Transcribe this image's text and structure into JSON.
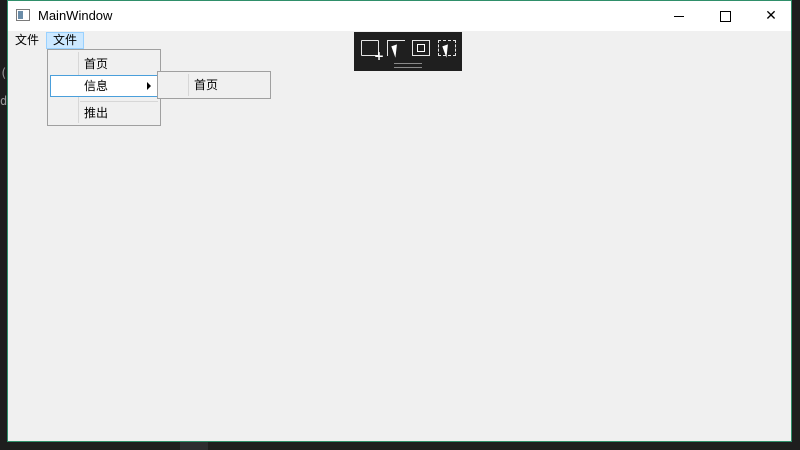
{
  "window": {
    "title": "MainWindow",
    "close_glyph": "✕",
    "border_color": "#2f8f6a"
  },
  "background_fragments": [
    "(/",
    "d"
  ],
  "menubar": {
    "items": [
      {
        "label": "文件"
      },
      {
        "label": "文件",
        "state": "open"
      }
    ]
  },
  "dropdown": {
    "items": [
      {
        "label": "首页"
      },
      {
        "label": "信息",
        "has_submenu": true,
        "state": "highlighted"
      },
      {
        "label": "推出"
      }
    ]
  },
  "submenu": {
    "items": [
      {
        "label": "首页"
      }
    ]
  },
  "debug_toolbar": {
    "icons": [
      "live-visual-tree-icon",
      "select-element-icon",
      "display-layout-adorners-icon",
      "track-focus-icon"
    ]
  },
  "colors": {
    "menu_highlight_bg": "#cce8ff",
    "menu_highlight_border": "#99d1ff",
    "submenu_highlight_border": "#4a9fdb"
  }
}
